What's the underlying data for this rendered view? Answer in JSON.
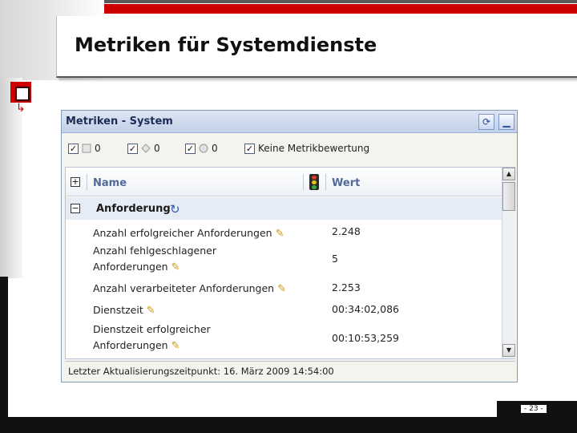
{
  "slide": {
    "title": "Metriken für Systemdienste",
    "page_number": "- 23 -"
  },
  "window": {
    "title": "Metriken - System",
    "buttons": {
      "refresh_icon": "refresh-icon",
      "minimize_icon": "minimize-icon"
    }
  },
  "toolbar": {
    "items": [
      {
        "checked": true,
        "icon": "error-icon",
        "count": "0"
      },
      {
        "checked": true,
        "icon": "warning-icon",
        "count": "0"
      },
      {
        "checked": true,
        "icon": "info-icon",
        "count": "0"
      },
      {
        "checked": true,
        "label": "Keine Metrikbewertung"
      }
    ]
  },
  "table": {
    "columns": {
      "name": "Name",
      "value": "Wert"
    },
    "group": {
      "label": "Anforderung"
    },
    "rows": [
      {
        "name_lines": [
          "Anzahl erfolgreicher Anforderungen"
        ],
        "value": "2.248"
      },
      {
        "name_lines": [
          "Anzahl fehlgeschlagener",
          "Anforderungen"
        ],
        "value": "5"
      },
      {
        "name_lines": [
          "Anzahl verarbeiteter Anforderungen"
        ],
        "value": "2.253"
      },
      {
        "name_lines": [
          "Dienstzeit"
        ],
        "value": "00:34:02,086"
      },
      {
        "name_lines": [
          "Dienstzeit erfolgreicher",
          "Anforderungen"
        ],
        "value": "00:10:53,259"
      }
    ]
  },
  "status": {
    "text": "Letzter Aktualisierungszeitpunkt: 16. März 2009 14:54:00"
  },
  "colors": {
    "accent_red": "#cc0000",
    "titlebar": "#c2d0e8",
    "header_text": "#4f6a9a"
  }
}
